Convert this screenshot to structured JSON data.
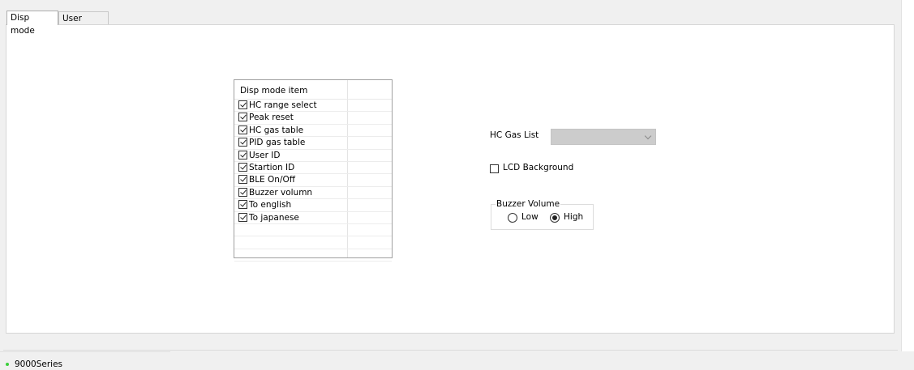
{
  "tabs": [
    {
      "label": "Disp mode",
      "active": true
    },
    {
      "label": "User mode",
      "active": false
    }
  ],
  "disp_list": {
    "header": "Disp mode item",
    "items": [
      {
        "label": "HC range select",
        "checked": true
      },
      {
        "label": "Peak reset",
        "checked": true
      },
      {
        "label": "HC gas table",
        "checked": true
      },
      {
        "label": "PID gas table",
        "checked": true
      },
      {
        "label": "User ID",
        "checked": true
      },
      {
        "label": "Startion ID",
        "checked": true
      },
      {
        "label": "BLE On/Off",
        "checked": true
      },
      {
        "label": "Buzzer volumn",
        "checked": true
      },
      {
        "label": "To english",
        "checked": true
      },
      {
        "label": "To japanese",
        "checked": true
      }
    ]
  },
  "hc_gas_list": {
    "label": "HC Gas List",
    "value": ""
  },
  "lcd_background": {
    "label": "LCD Background",
    "checked": false
  },
  "buzzer_volume": {
    "legend": "Buzzer Volume",
    "options": [
      {
        "label": "Low",
        "selected": false
      },
      {
        "label": "High",
        "selected": true
      }
    ]
  },
  "status": {
    "text": "9000Series",
    "dot_color": "#3ccf3c"
  }
}
